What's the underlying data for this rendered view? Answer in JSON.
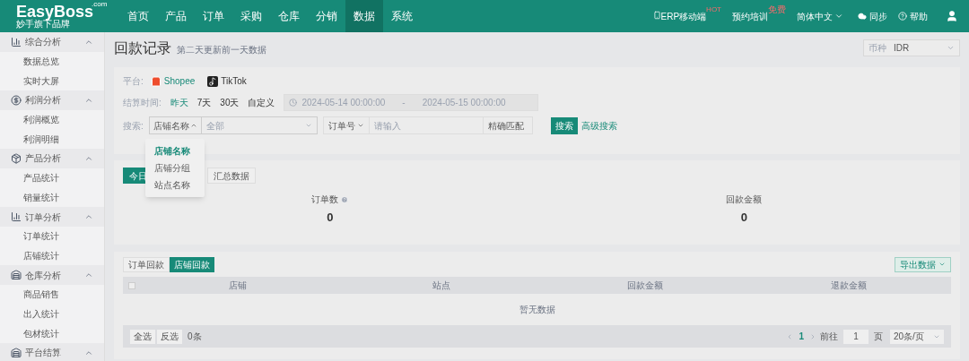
{
  "logo": {
    "name": "EasyBoss",
    "suffix": ".com",
    "tagline": "妙手旗下品牌"
  },
  "nav": [
    {
      "label": "首页",
      "selected": false
    },
    {
      "label": "产品",
      "selected": false
    },
    {
      "label": "订单",
      "selected": false
    },
    {
      "label": "采购",
      "selected": false
    },
    {
      "label": "仓库",
      "selected": false
    },
    {
      "label": "分销",
      "selected": false
    },
    {
      "label": "数据",
      "selected": true
    },
    {
      "label": "系统",
      "selected": false
    }
  ],
  "header_right": {
    "mobile": {
      "label": "ERP移动端",
      "badge": "HOT"
    },
    "training": {
      "label": "预约培训",
      "badge": "免费"
    },
    "language": "简体中文",
    "sync": "同步",
    "help": "帮助"
  },
  "sidebar": [
    {
      "label": "综合分析",
      "expanded": true,
      "children": [
        {
          "label": "数据总览"
        },
        {
          "label": "实时大屏"
        }
      ]
    },
    {
      "label": "利润分析",
      "expanded": true,
      "children": [
        {
          "label": "利润概览"
        },
        {
          "label": "利润明细"
        }
      ]
    },
    {
      "label": "产品分析",
      "expanded": true,
      "children": [
        {
          "label": "产品统计"
        },
        {
          "label": "销量统计"
        }
      ]
    },
    {
      "label": "订单分析",
      "expanded": true,
      "children": [
        {
          "label": "订单统计"
        },
        {
          "label": "店铺统计"
        }
      ]
    },
    {
      "label": "仓库分析",
      "expanded": true,
      "children": [
        {
          "label": "商品销售"
        },
        {
          "label": "出入统计"
        },
        {
          "label": "包材统计"
        }
      ]
    },
    {
      "label": "平台结算",
      "expanded": true
    }
  ],
  "page": {
    "title": "回款记录",
    "subtitle": "第二天更新前一天数据",
    "currency": {
      "label": "币种",
      "value": "IDR"
    }
  },
  "filters": {
    "platform_label": "平台:",
    "platforms": [
      {
        "name": "Shopee",
        "kind": "shopee",
        "selected": true
      },
      {
        "name": "TikTok",
        "kind": "tiktok",
        "selected": false
      }
    ],
    "time_label": "结算时间:",
    "time_options": [
      {
        "label": "昨天",
        "selected": true
      },
      {
        "label": "7天",
        "selected": false
      },
      {
        "label": "30天",
        "selected": false
      },
      {
        "label": "自定义",
        "selected": false
      }
    ],
    "date_start": "2024-05-14 00:00:00",
    "date_sep": "-",
    "date_end": "2024-05-15 00:00:00",
    "search_label": "搜索:",
    "search_field": "店铺名称",
    "search_value_placeholder": "全部",
    "order_field": "订单号",
    "order_placeholder": "请输入",
    "match": "精确匹配",
    "search_button": "搜索",
    "advanced": "高级搜索"
  },
  "dropdown": [
    {
      "label": "店铺名称",
      "selected": true
    },
    {
      "label": "店铺分组",
      "selected": false
    },
    {
      "label": "站点名称",
      "selected": false
    }
  ],
  "stats_tabs": [
    {
      "label": "今日",
      "selected": true
    },
    {
      "label": "汇总数据",
      "selected": false
    }
  ],
  "metrics": [
    {
      "label": "订单数",
      "help": true,
      "value": "0"
    },
    {
      "label": "回款金额",
      "help": false,
      "value": "0"
    }
  ],
  "table": {
    "tabs": [
      {
        "label": "订单回款",
        "selected": false
      },
      {
        "label": "店铺回款",
        "selected": true
      }
    ],
    "export": "导出数据",
    "header_checked": false,
    "columns": [
      "店铺",
      "站点",
      "回款金额",
      "退款金额"
    ],
    "empty": "暂无数据",
    "footer": {
      "select_all": "全选",
      "invert": "反选",
      "count": "0条",
      "page": "1",
      "goto": "前往",
      "goto_value": "1",
      "page_unit": "页",
      "page_size": "20条/页"
    }
  }
}
